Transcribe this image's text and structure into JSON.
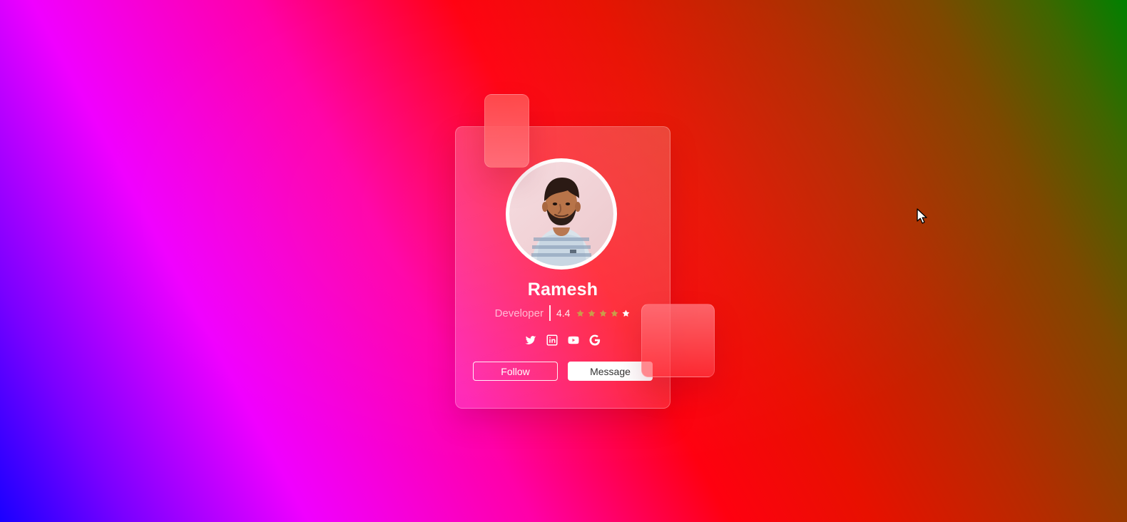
{
  "colors": {
    "accent": "#ff2f8f",
    "star": "#c99d4a",
    "star_empty": "#ffffff",
    "button_text": "#333333",
    "text": "#ffffff"
  },
  "profile": {
    "name": "Ramesh",
    "role": "Developer",
    "rating": "4.4",
    "stars": [
      {
        "name": "star-filled-icon"
      },
      {
        "name": "star-filled-icon"
      },
      {
        "name": "star-filled-icon"
      },
      {
        "name": "star-filled-icon"
      },
      {
        "name": "star-empty-icon"
      }
    ]
  },
  "social_links": [
    {
      "name": "twitter-icon"
    },
    {
      "name": "linkedin-icon"
    },
    {
      "name": "youtube-icon"
    },
    {
      "name": "google-icon"
    }
  ],
  "actions": {
    "follow_label": "Follow",
    "message_label": "Message"
  }
}
